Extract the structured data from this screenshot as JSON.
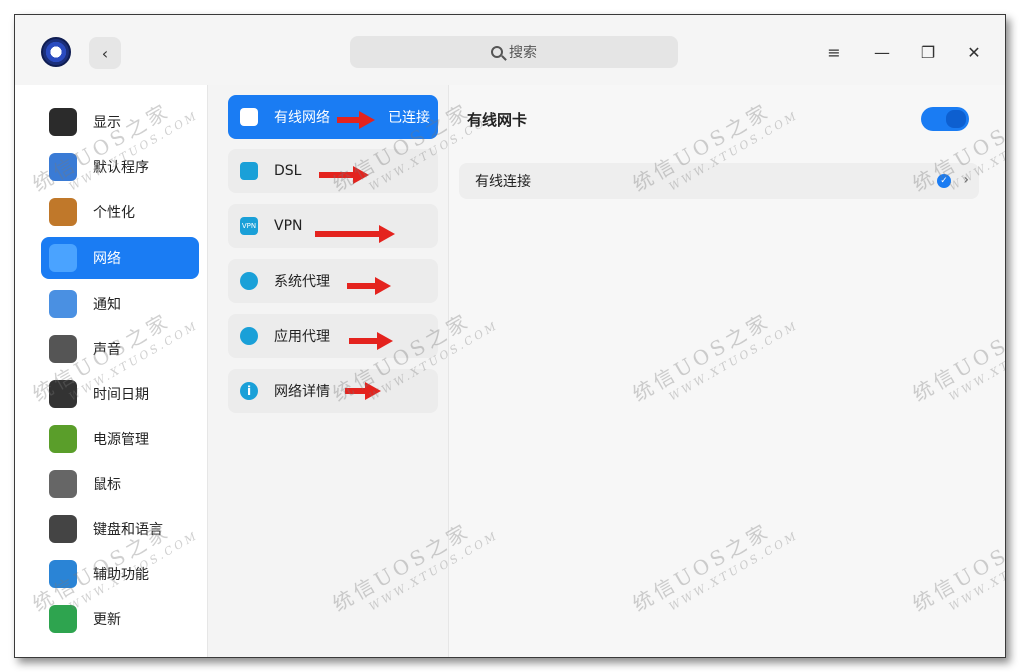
{
  "search": {
    "placeholder": "搜索"
  },
  "nav": {
    "items": [
      {
        "label": "显示",
        "icon": "monitor-icon",
        "color": "#2b2b2b"
      },
      {
        "label": "默认程序",
        "icon": "default-apps-icon",
        "color": "#3a7bd5"
      },
      {
        "label": "个性化",
        "icon": "palette-icon",
        "color": "#c0782a"
      },
      {
        "label": "网络",
        "icon": "network-icon",
        "color": "#4aa3ff",
        "active": true
      },
      {
        "label": "通知",
        "icon": "notification-icon",
        "color": "#4a90e2"
      },
      {
        "label": "声音",
        "icon": "speaker-icon",
        "color": "#555555"
      },
      {
        "label": "时间日期",
        "icon": "clock-icon",
        "color": "#333333"
      },
      {
        "label": "电源管理",
        "icon": "battery-icon",
        "color": "#5a9e2a"
      },
      {
        "label": "鼠标",
        "icon": "mouse-icon",
        "color": "#666666"
      },
      {
        "label": "键盘和语言",
        "icon": "keyboard-icon",
        "color": "#444444"
      },
      {
        "label": "辅助功能",
        "icon": "accessibility-icon",
        "color": "#2a84d6"
      },
      {
        "label": "更新",
        "icon": "update-icon",
        "color": "#2ea44f"
      }
    ]
  },
  "network_menu": {
    "items": [
      {
        "label": "有线网络",
        "status": "已连接",
        "icon": "wired-network-icon",
        "color": "#ffffff",
        "active": true
      },
      {
        "label": "DSL",
        "icon": "dsl-icon",
        "color": "#1aa0d8"
      },
      {
        "label": "VPN",
        "icon": "vpn-icon",
        "icon_text": "VPN",
        "color": "#1aa0d8"
      },
      {
        "label": "系统代理",
        "icon": "system-proxy-icon",
        "color": "#1aa0d8"
      },
      {
        "label": "应用代理",
        "icon": "app-proxy-icon",
        "color": "#1aa0d8"
      },
      {
        "label": "网络详情",
        "icon": "info-icon",
        "color": "#1aa0d8"
      }
    ]
  },
  "detail": {
    "title": "有线网卡",
    "toggle_on": true,
    "connections": [
      {
        "name": "有线连接",
        "connected": true
      }
    ]
  },
  "watermark": {
    "text": "统信UOS之家",
    "url": "WWW.XTUOS.COM"
  },
  "colors": {
    "accent": "#1a7cf3",
    "arrow": "#e4231e"
  }
}
